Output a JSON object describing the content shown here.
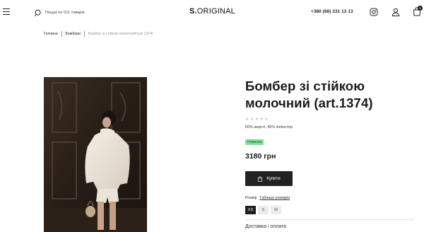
{
  "header": {
    "search_placeholder": "Пошук по 511 товарів",
    "logo_bold": "S.",
    "logo_rest": "ORIGINAL",
    "phone": "+380 (68) 331 13 13",
    "cart_count": "1"
  },
  "breadcrumb": {
    "home": "Головна",
    "category": "Бомбери",
    "current": "Бомбер зі стійкою молочний (art.1374)"
  },
  "product": {
    "title": "Бомбер зі стійкою молочний (art.1374)",
    "rating_stars": [
      "★",
      "★",
      "★",
      "★",
      "★"
    ],
    "composition": "60% шерсті, 40% полієстер",
    "badge": "Новинка",
    "price": "3180 грн",
    "buy_label": "Купити",
    "size_label": "Розмір",
    "size_table_link": "Таблиця розмірів",
    "sizes": [
      "XS",
      "S",
      "M"
    ],
    "selected_size": "XS",
    "delivery_label": "Доставка і оплата"
  },
  "colors": {
    "badge_bg": "#7fe49a",
    "button_bg": "#222222"
  }
}
